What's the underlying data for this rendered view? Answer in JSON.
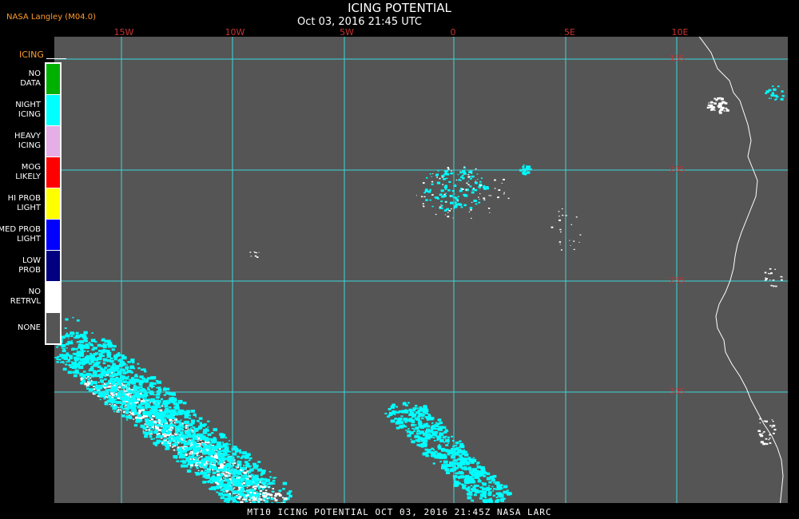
{
  "header": {
    "title": "ICING POTENTIAL",
    "subtitle": "Oct 03, 2016 21:45 UTC",
    "source": "NASA Langley (M04.0)"
  },
  "map": {
    "longitude_labels": [
      "15W",
      "10W",
      "5W",
      "0",
      "5E",
      "10E"
    ],
    "latitude_labels": [
      "15S",
      "20S",
      "25S",
      "30S"
    ],
    "grid_color": "#3ad6dc",
    "background_color": "#555555",
    "coast_color": "#ffffff",
    "icing_colors": {
      "night_icing": "#00ffff",
      "no_retrieval": "#ffffff"
    }
  },
  "legend": {
    "title": "ICING",
    "items": [
      {
        "label": "NO DATA",
        "color": "#00b000"
      },
      {
        "label": "NIGHT ICING",
        "color": "#00ffff"
      },
      {
        "label": "HEAVY ICING",
        "color": "#e6aee6"
      },
      {
        "label": "MOG LIKELY",
        "color": "#ff0000"
      },
      {
        "label": "HI PROB LIGHT",
        "color": "#ffff00"
      },
      {
        "label": "MED PROB LIGHT",
        "color": "#0000ff"
      },
      {
        "label": "LOW PROB",
        "color": "#000080"
      },
      {
        "label": "NO RETRVL",
        "color": "#ffffff"
      },
      {
        "label": "NONE",
        "color": "#555555"
      }
    ]
  },
  "footer": {
    "text": "MT10  ICING POTENTIAL   OCT 03, 2016 21:45Z   NASA LARC"
  }
}
